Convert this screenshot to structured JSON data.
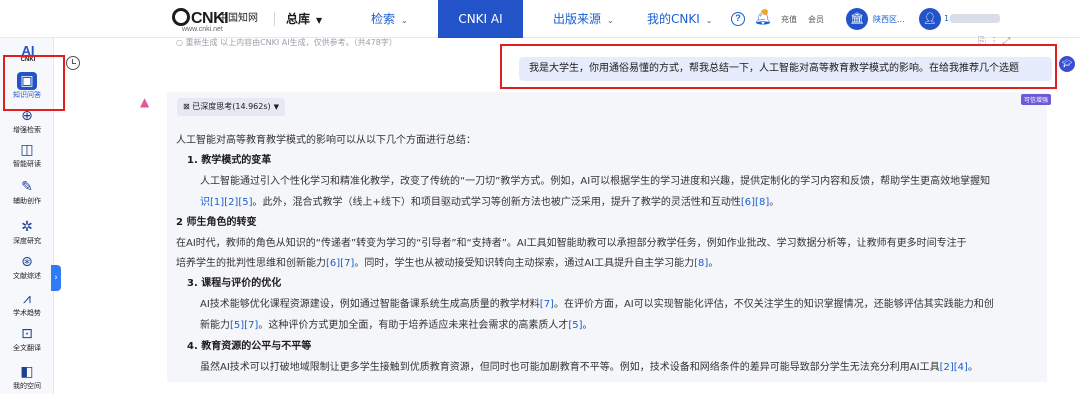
{
  "topbar": {
    "logo_text": "CNKI",
    "logo_cn": "中国知网",
    "logo_url": "www.cnki.net",
    "nav": {
      "zongku": "总库",
      "jiansuo": "检索",
      "cnki_ai": "CNKI AI",
      "chuban": "出版来源",
      "mycnki": "我的CNKI"
    },
    "help": "?",
    "chongzhi": "充值",
    "huiyuan": "会员",
    "org_name": "陕西区...",
    "user_name": "1"
  },
  "sidebar": {
    "brand_ai": "AI",
    "brand_cnki": "CNKI",
    "items": [
      {
        "label": "知识问答",
        "icon": "chat-icon"
      },
      {
        "label": "增强检索",
        "icon": "search-plus-icon"
      },
      {
        "label": "智能研读",
        "icon": "book-icon"
      },
      {
        "label": "辅助创作",
        "icon": "pen-icon"
      },
      {
        "label": "深度研究",
        "icon": "atom-icon"
      },
      {
        "label": "文献综述",
        "icon": "target-icon"
      },
      {
        "label": "学术趋势",
        "icon": "trend-icon"
      },
      {
        "label": "全文翻译",
        "icon": "translate-icon"
      },
      {
        "label": "我的空间",
        "icon": "folder-icon"
      }
    ]
  },
  "chat": {
    "faded_top": "○ 重新生成 以上内容由CNKI AI生成，仅供参考。（共478字）",
    "user_message": "我是大学生，你用通俗易懂的方式，帮我总结一下，人工智能对高等教育教学模式的影响。在给我推荐几个选题",
    "trust_badge": "可信增强",
    "deep_think": "已深度思考(14.962s)",
    "answer": {
      "intro": "人工智能对高等教育教学模式的影响可以从以下几个方面进行总结：",
      "h1": "1. 教学模式的变革",
      "p1a": "人工智能通过引入个性化学习和精准化教学，改变了传统的“一刀切”教学方式。例如，AI可以根据学生的学习进度和兴趣，提供定制化的学习内容和反馈，帮助学生更高效地掌握知",
      "p1b_cite1": "识[1][2][5]",
      "p1b_text": "。此外，混合式教学（线上+线下）和项目驱动式学习等创新方法也被广泛采用，提升了教学的灵活性和互动性",
      "p1b_cite2": "[6][8]",
      "p1b_end": "。",
      "h2": "2 师生角色的转变",
      "p2a": "在AI时代，教师的角色从知识的“传递者”转变为学习的“引导者”和“支持者”。AI工具如智能助教可以承担部分教学任务，例如作业批改、学习数据分析等，让教师有更多时间专注于",
      "p2b_text1": "培养学生的批判性思维和创新能力",
      "p2b_cite1": "[6][7]",
      "p2b_text2": "。同时，学生也从被动接受知识转向主动探索，通过AI工具提升自主学习能力",
      "p2b_cite2": "[8]",
      "p2b_end": "。",
      "h3": "3. 课程与评价的优化",
      "p3a_text1": "AI技术能够优化课程资源建设，例如通过智能备课系统生成高质量的教学材料",
      "p3a_cite1": "[7]",
      "p3a_text2": "。在评价方面，AI可以实现智能化评估，不仅关注学生的知识掌握情况，还能够评估其实践能力和创",
      "p3b_text1": "新能力",
      "p3b_cite1": "[5][7]",
      "p3b_text2": "。这种评价方式更加全面，有助于培养适应未来社会需求的高素质人才",
      "p3b_cite2": "[5]",
      "p3b_end": "。",
      "h4": "4. 教育资源的公平与不平等",
      "p4_text": "虽然AI技术可以打破地域限制让更多学生接触到优质教育资源，但同时也可能加剧教育不平等。例如，技术设备和网络条件的差异可能导致部分学生无法充分利用AI工具",
      "p4_cite": "[2][4]",
      "p4_end": "。"
    }
  },
  "colors": {
    "brand_blue": "#2253c8",
    "link_blue": "#1a5fd1",
    "highlight_red": "#e02020",
    "bubble_bg": "#e6ecfb",
    "panel_bg": "#f5f6fa"
  }
}
